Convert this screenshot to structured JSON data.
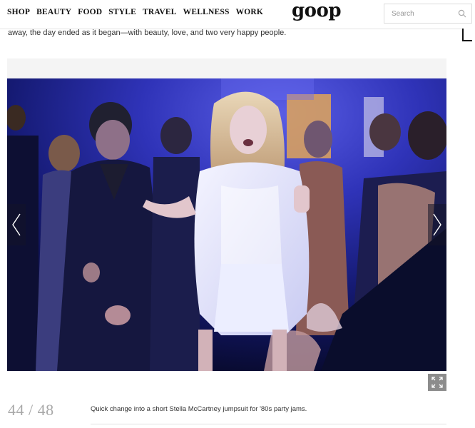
{
  "header": {
    "nav": [
      "SHOP",
      "BEAUTY",
      "FOOD",
      "STYLE",
      "TRAVEL",
      "WELLNESS",
      "WORK"
    ],
    "logo": "goop",
    "search_placeholder": "Search"
  },
  "article": {
    "intro_text": "away, the day ended as it began—with beauty, love, and two very happy people."
  },
  "gallery": {
    "counter": "44 / 48",
    "caption": "Quick change into a short Stella McCartney jumpsuit for '80s party jams.",
    "icons": [
      "chevron-left-icon",
      "chevron-right-icon",
      "fullscreen-icon",
      "search-icon"
    ]
  }
}
